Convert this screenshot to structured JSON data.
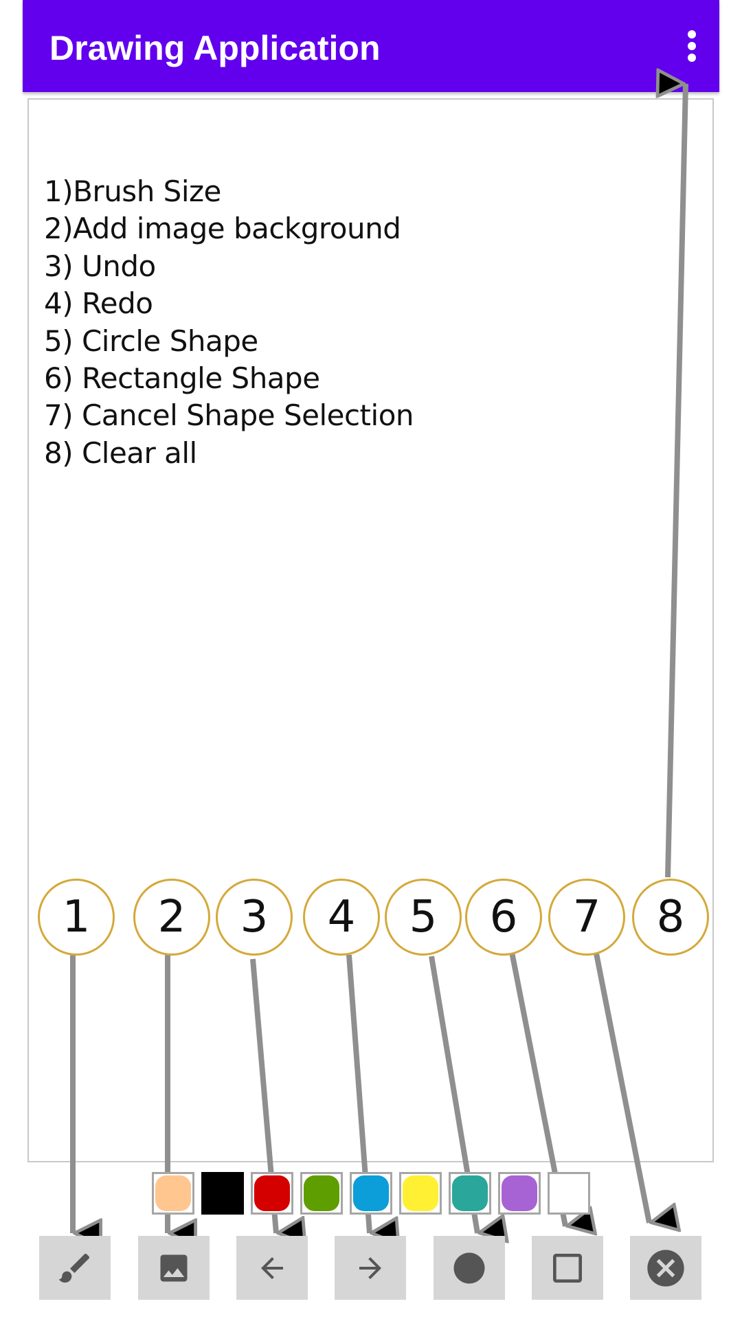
{
  "app_bar": {
    "title": "Drawing Application",
    "menu_icon": "more-vert-icon",
    "color": "#6200ee"
  },
  "instructions": [
    "1)Brush Size",
    "2)Add image background",
    "3) Undo",
    "4) Redo",
    "5) Circle Shape",
    "6) Rectangle Shape",
    "7) Cancel Shape Selection",
    "8) Clear all"
  ],
  "callout_numbers": [
    "1",
    "2",
    "3",
    "4",
    "5",
    "6",
    "7",
    "8"
  ],
  "palette": {
    "colors": [
      "#ffc690",
      "#000000",
      "#d40000",
      "#5e9e00",
      "#0b9ed9",
      "#fff033",
      "#2aa69b",
      "#a763d4",
      "#ffffff"
    ]
  },
  "toolbar": {
    "buttons": [
      {
        "name": "brush-size-button",
        "icon": "brush-icon"
      },
      {
        "name": "image-background-button",
        "icon": "image-icon"
      },
      {
        "name": "undo-button",
        "icon": "arrow-left-icon"
      },
      {
        "name": "redo-button",
        "icon": "arrow-right-icon"
      },
      {
        "name": "circle-shape-button",
        "icon": "circle-icon"
      },
      {
        "name": "rectangle-shape-button",
        "icon": "square-outline-icon"
      },
      {
        "name": "cancel-shape-button",
        "icon": "cancel-circle-icon"
      }
    ]
  }
}
